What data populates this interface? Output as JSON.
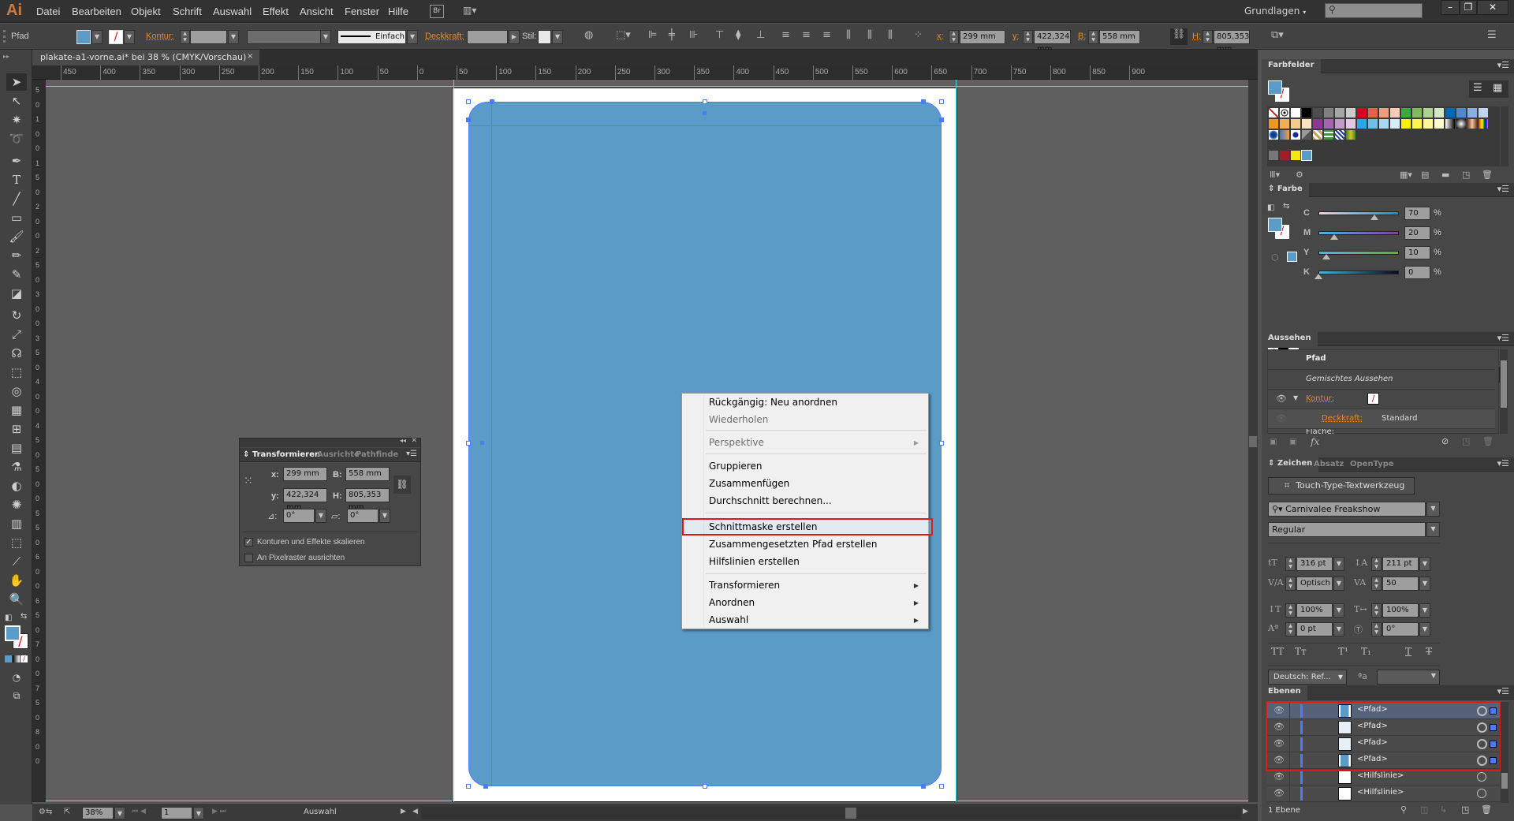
{
  "app": {
    "logo": "Ai",
    "menus": [
      "Datei",
      "Bearbeiten",
      "Objekt",
      "Schrift",
      "Auswahl",
      "Effekt",
      "Ansicht",
      "Fenster",
      "Hilfe"
    ],
    "bridge_label": "Br",
    "workspace": "Grundlagen",
    "search_placeholder": "",
    "window_controls": {
      "minimize": "–",
      "restore": "❐",
      "close": "✕"
    }
  },
  "control_bar": {
    "object_type": "Pfad",
    "stroke_label": "Kontur:",
    "stroke_profile": "Einfach",
    "opacity_label": "Deckkraft:",
    "style_label": "Stil:",
    "x_label": "x:",
    "x_value": "299 mm",
    "y_label": "y:",
    "y_value": "422,324 mm",
    "w_label": "B:",
    "w_value": "558 mm",
    "h_label": "H:",
    "h_value": "805,353 mm",
    "fill_color": "#5b9bc8"
  },
  "document": {
    "tab_title": "plakate-a1-vorne.ai* bei 38 % (CMYK/Vorschau)",
    "close": "×",
    "ruler_h": [
      "450",
      "400",
      "350",
      "300",
      "250",
      "200",
      "150",
      "100",
      "50",
      "0",
      "50",
      "100",
      "150",
      "200",
      "250",
      "300",
      "350",
      "400",
      "450",
      "500",
      "550",
      "600",
      "650",
      "700",
      "750",
      "800",
      "850",
      "900"
    ],
    "ruler_v": [
      "5",
      "0",
      "1",
      "0",
      "0",
      "1",
      "5",
      "0",
      "2",
      "0",
      "0",
      "2",
      "5",
      "0",
      "3",
      "0",
      "0",
      "3",
      "5",
      "0",
      "4",
      "0",
      "0",
      "4",
      "5",
      "0",
      "5",
      "0",
      "0",
      "5",
      "5",
      "0",
      "6",
      "0",
      "0",
      "6",
      "5",
      "0",
      "7",
      "0",
      "0",
      "7",
      "5",
      "0",
      "8",
      "0",
      "0"
    ],
    "shape_color": "#5b9bc8",
    "guide_color": "#39e8ec",
    "selection_color": "#4a7cff"
  },
  "transform_panel": {
    "tabs": [
      "Transformieren",
      "Ausrichte",
      "Pathfinde"
    ],
    "x_label": "x:",
    "x_value": "299 mm",
    "y_label": "y:",
    "y_value": "422,324 mm",
    "w_label": "B:",
    "w_value": "558 mm",
    "h_label": "H:",
    "h_value": "805,353 mm",
    "rotate_value": "0°",
    "shear_value": "0°",
    "scale_strokes_label": "Konturen und Effekte skalieren",
    "scale_strokes_checked": true,
    "pixel_align_label": "An Pixelraster ausrichten",
    "pixel_align_checked": false
  },
  "context_menu": {
    "items": [
      {
        "label": "Rückgängig: Neu anordnen",
        "disabled": false
      },
      {
        "label": "Wiederholen",
        "disabled": true
      },
      {
        "label": "Perspektive",
        "disabled": true,
        "submenu": true
      },
      {
        "label": "Gruppieren",
        "disabled": false
      },
      {
        "label": "Zusammenfügen",
        "disabled": false
      },
      {
        "label": "Durchschnitt berechnen...",
        "disabled": false
      },
      {
        "label": "Schnittmaske erstellen",
        "disabled": false,
        "highlighted": true
      },
      {
        "label": "Zusammengesetzten Pfad erstellen",
        "disabled": false
      },
      {
        "label": "Hilfslinien erstellen",
        "disabled": false
      },
      {
        "label": "Transformieren",
        "disabled": false,
        "submenu": true
      },
      {
        "label": "Anordnen",
        "disabled": false,
        "submenu": true
      },
      {
        "label": "Auswahl",
        "disabled": false,
        "submenu": true
      }
    ],
    "highlight_color": "#e01818"
  },
  "swatches_panel": {
    "title": "Farbfelder",
    "row1": [
      "none",
      "registration",
      "#ffffff",
      "#000000",
      "#4d4d4d",
      "#808080",
      "#a6a6a6",
      "#cccccc",
      "#d7001f",
      "#e0624a",
      "#ec9f80",
      "#f5cdb6",
      "#3ea83a",
      "#7fba5e",
      "#a9d38e",
      "#d4e8c5",
      "#0067b4",
      "#5088c9",
      "#8aaedd",
      "#c3d3ee"
    ],
    "row2": [
      "#ec9a1a",
      "#f1b055",
      "#f6cc8c",
      "#fbe3c2",
      "#8e3596",
      "#a565ac",
      "#c29bc8",
      "#dfc8e2",
      "#28a8e0",
      "#6cc0ea",
      "#a7d7f2",
      "#d6ecf9",
      "#fff000",
      "#fff450",
      "#fff799",
      "#fffbcc",
      "gradient-bw",
      "gradient-radial",
      "gradient-copper",
      "gradient-rainbow"
    ],
    "row3": [
      "pattern-1",
      "pattern-2",
      "pattern-3",
      "pattern-4",
      "pattern-5",
      "pattern-6",
      "pattern-7",
      "pattern-8"
    ],
    "row4": [
      "folder",
      "#a41b2a",
      "#f5e612",
      "#5b9bc8"
    ]
  },
  "color_panel": {
    "title": "Farbe",
    "channels": [
      {
        "label": "C",
        "value": "70",
        "fraction": 0.7
      },
      {
        "label": "M",
        "value": "20",
        "fraction": 0.2
      },
      {
        "label": "Y",
        "value": "10",
        "fraction": 0.1
      },
      {
        "label": "K",
        "value": "0",
        "fraction": 0.0
      }
    ],
    "unit": "%"
  },
  "appearance_panel": {
    "title": "Aussehen",
    "object": "Pfad",
    "mixed": "Gemischtes Aussehen",
    "stroke_label": "Kontur:",
    "opacity_label": "Deckkraft:",
    "opacity_value": "Standard",
    "fill_label": "Fläche:",
    "fx_label": "fx"
  },
  "character_panel": {
    "tabs": [
      "Zeichen",
      "Absatz",
      "OpenType"
    ],
    "touch_type": "Touch-Type-Textwerkzeug",
    "font_family": "Carnivalee Freakshow",
    "font_style": "Regular",
    "font_size": "316 pt",
    "leading": "211 pt",
    "kerning": "Optisch",
    "tracking": "50",
    "vertical_scale": "100%",
    "horizontal_scale": "100%",
    "baseline_shift": "0 pt",
    "rotation": "0°",
    "language": "Deutsch: Ref...",
    "antialias": ""
  },
  "layers_panel": {
    "title": "Ebenen",
    "rows": [
      {
        "name": "<Pfad>",
        "selected": true,
        "thumb": "blue"
      },
      {
        "name": "<Pfad>",
        "selected": false,
        "thumb": "light"
      },
      {
        "name": "<Pfad>",
        "selected": false,
        "thumb": "light"
      },
      {
        "name": "<Pfad>",
        "selected": false,
        "thumb": "blue"
      },
      {
        "name": "<Hilfslinie>",
        "selected": false,
        "thumb": "white"
      },
      {
        "name": "<Hilfslinie>",
        "selected": false,
        "thumb": "white"
      }
    ],
    "footer": "1 Ebene"
  },
  "status_bar": {
    "zoom": "38%",
    "artboard": "1",
    "tool": "Auswahl"
  }
}
